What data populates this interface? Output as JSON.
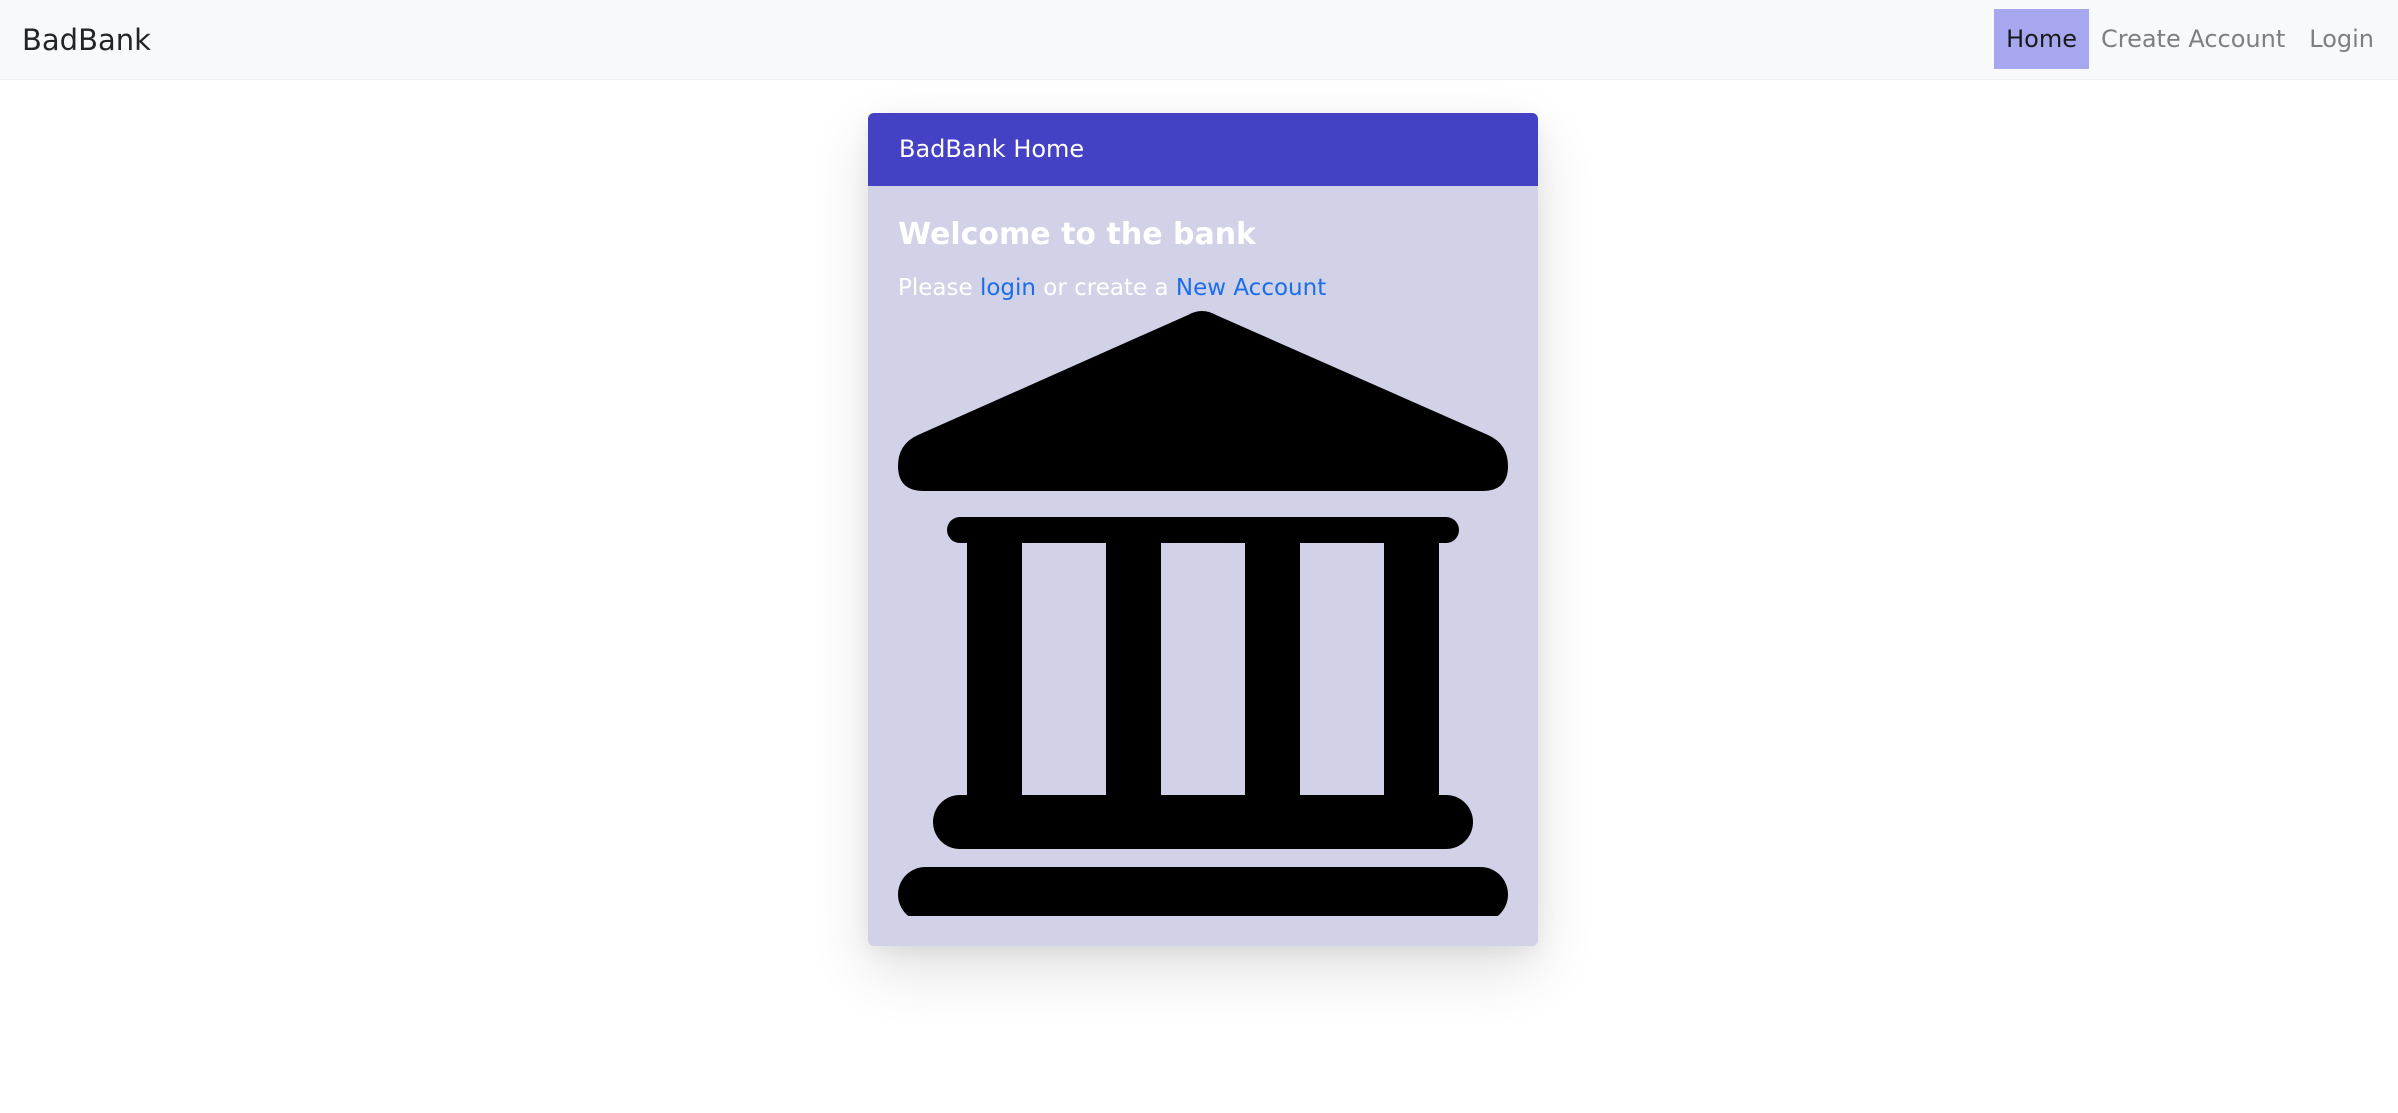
{
  "navbar": {
    "brand": "BadBank",
    "links": [
      {
        "label": "Home",
        "active": true
      },
      {
        "label": "Create Account",
        "active": false
      },
      {
        "label": "Login",
        "active": false
      }
    ]
  },
  "card": {
    "header": "BadBank Home",
    "title": "Welcome to the bank",
    "text": {
      "prefix": "Please ",
      "login_link": "login",
      "middle": " or create a ",
      "new_account_link": "New Account"
    },
    "image_icon": "bank-icon"
  },
  "colors": {
    "card_header": "#4441c4",
    "card_body": "#d1d1e7",
    "active_nav": "#a7a7f0",
    "link": "#1a6ee8"
  }
}
